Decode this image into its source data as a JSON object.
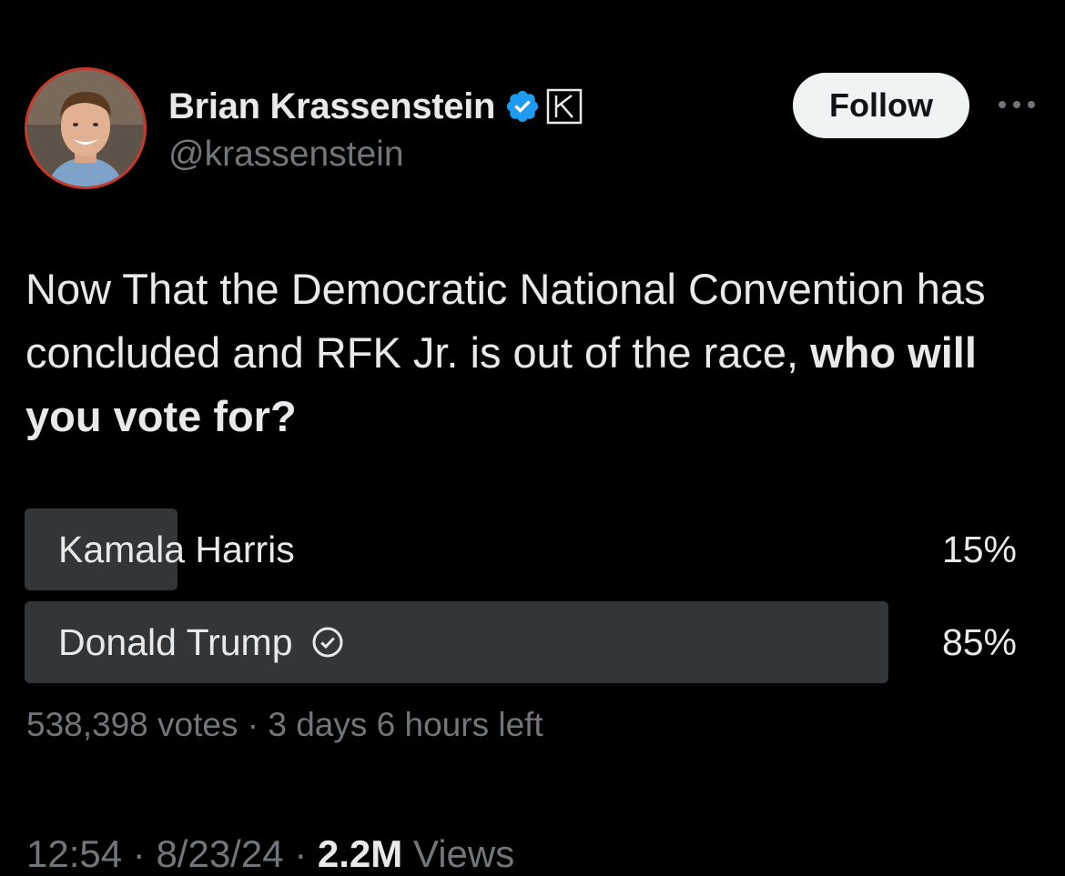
{
  "author": {
    "display_name": "Brian Krassenstein",
    "handle": "@krassenstein",
    "verified_icon": "verified-badge-icon",
    "affiliate_icon": "k-affiliate-badge-icon"
  },
  "actions": {
    "follow_label": "Follow",
    "more_icon": "more-options-icon"
  },
  "tweet": {
    "text_regular": "Now That the Democratic National Convention has concluded and RFK Jr. is out of the race, ",
    "text_bold": "who will you vote for?"
  },
  "poll": {
    "options": [
      {
        "label": "Kamala Harris",
        "percent_label": "15%",
        "share": 0.15,
        "selected": false
      },
      {
        "label": "Donald Trump",
        "percent_label": "85%",
        "share": 0.85,
        "selected": true
      }
    ],
    "votes": "538,398 votes",
    "separator": " · ",
    "time_left": "3 days 6 hours left"
  },
  "footer": {
    "time": "12:54",
    "date": "8/23/24",
    "views_count": "2.2M",
    "views_label": "Views",
    "separator": " · "
  },
  "colors": {
    "background": "#000000",
    "text": "#e7e9ea",
    "muted": "#71767b",
    "poll_bar": "#333639",
    "verified": "#1d9bf0",
    "follow_bg": "#eff3f4",
    "avatar_ring": "#c8382b"
  }
}
